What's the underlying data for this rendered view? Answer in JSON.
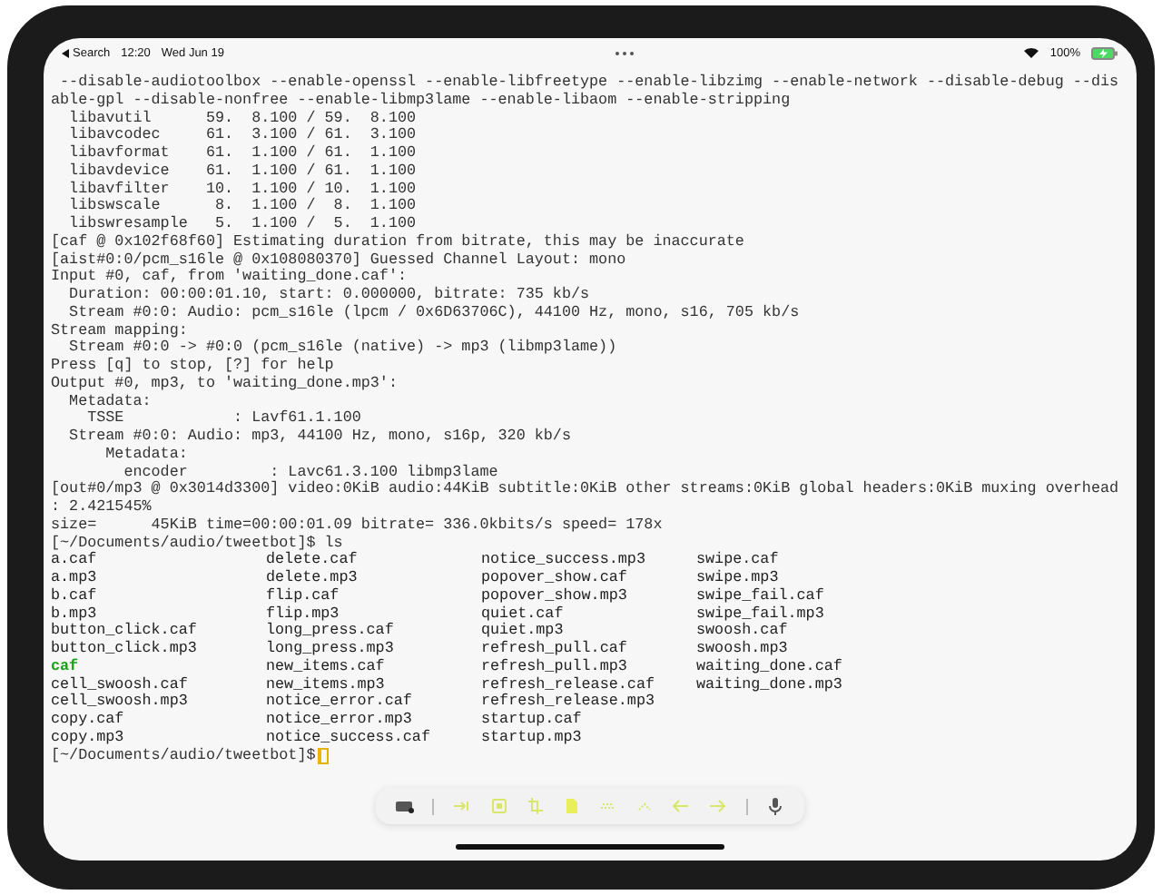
{
  "status_bar": {
    "back_label": "Search",
    "time": "12:20",
    "date": "Wed Jun 19",
    "battery": "100%",
    "charging": true
  },
  "terminal": {
    "lines": [
      {
        "kind": "output",
        "text": " --disable-audiotoolbox --enable-openssl --enable-libfreetype --enable-libzimg --enable-network --disable-debug --dis"
      },
      {
        "kind": "output",
        "text": "able-gpl --disable-nonfree --enable-libmp3lame --enable-libaom --enable-stripping"
      },
      {
        "kind": "output",
        "text": "  libavutil      59.  8.100 / 59.  8.100"
      },
      {
        "kind": "output",
        "text": "  libavcodec     61.  3.100 / 61.  3.100"
      },
      {
        "kind": "output",
        "text": "  libavformat    61.  1.100 / 61.  1.100"
      },
      {
        "kind": "output",
        "text": "  libavdevice    61.  1.100 / 61.  1.100"
      },
      {
        "kind": "output",
        "text": "  libavfilter    10.  1.100 / 10.  1.100"
      },
      {
        "kind": "output",
        "text": "  libswscale      8.  1.100 /  8.  1.100"
      },
      {
        "kind": "output",
        "text": "  libswresample   5.  1.100 /  5.  1.100"
      },
      {
        "kind": "output",
        "text": "[caf @ 0x102f68f60] Estimating duration from bitrate, this may be inaccurate"
      },
      {
        "kind": "output",
        "text": "[aist#0:0/pcm_s16le @ 0x108080370] Guessed Channel Layout: mono"
      },
      {
        "kind": "output",
        "text": "Input #0, caf, from 'waiting_done.caf':"
      },
      {
        "kind": "output",
        "text": "  Duration: 00:00:01.10, start: 0.000000, bitrate: 735 kb/s"
      },
      {
        "kind": "output",
        "text": "  Stream #0:0: Audio: pcm_s16le (lpcm / 0x6D63706C), 44100 Hz, mono, s16, 705 kb/s"
      },
      {
        "kind": "output",
        "text": "Stream mapping:"
      },
      {
        "kind": "output",
        "text": "  Stream #0:0 -> #0:0 (pcm_s16le (native) -> mp3 (libmp3lame))"
      },
      {
        "kind": "output",
        "text": "Press [q] to stop, [?] for help"
      },
      {
        "kind": "output",
        "text": "Output #0, mp3, to 'waiting_done.mp3':"
      },
      {
        "kind": "output",
        "text": "  Metadata:"
      },
      {
        "kind": "output",
        "text": "    TSSE            : Lavf61.1.100"
      },
      {
        "kind": "output",
        "text": "  Stream #0:0: Audio: mp3, 44100 Hz, mono, s16p, 320 kb/s"
      },
      {
        "kind": "output",
        "text": "      Metadata:"
      },
      {
        "kind": "output",
        "text": "        encoder         : Lavc61.3.100 libmp3lame"
      },
      {
        "kind": "output",
        "text": "[out#0/mp3 @ 0x3014d3300] video:0KiB audio:44KiB subtitle:0KiB other streams:0KiB global headers:0KiB muxing overhead"
      },
      {
        "kind": "output",
        "text": ": 2.421545%"
      },
      {
        "kind": "output",
        "text": "size=      45KiB time=00:00:01.09 bitrate= 336.0kbits/s speed= 178x"
      }
    ],
    "command": "[~/Documents/audio/tweetbot]$ ls",
    "listing": [
      [
        {
          "name": "a.caf",
          "kind": "file"
        },
        {
          "name": "delete.caf",
          "kind": "file"
        },
        {
          "name": "notice_success.mp3",
          "kind": "file"
        },
        {
          "name": "swipe.caf",
          "kind": "file"
        }
      ],
      [
        {
          "name": "a.mp3",
          "kind": "file"
        },
        {
          "name": "delete.mp3",
          "kind": "file"
        },
        {
          "name": "popover_show.caf",
          "kind": "file"
        },
        {
          "name": "swipe.mp3",
          "kind": "file"
        }
      ],
      [
        {
          "name": "b.caf",
          "kind": "file"
        },
        {
          "name": "flip.caf",
          "kind": "file"
        },
        {
          "name": "popover_show.mp3",
          "kind": "file"
        },
        {
          "name": "swipe_fail.caf",
          "kind": "file"
        }
      ],
      [
        {
          "name": "b.mp3",
          "kind": "file"
        },
        {
          "name": "flip.mp3",
          "kind": "file"
        },
        {
          "name": "quiet.caf",
          "kind": "file"
        },
        {
          "name": "swipe_fail.mp3",
          "kind": "file"
        }
      ],
      [
        {
          "name": "button_click.caf",
          "kind": "file"
        },
        {
          "name": "long_press.caf",
          "kind": "file"
        },
        {
          "name": "quiet.mp3",
          "kind": "file"
        },
        {
          "name": "swoosh.caf",
          "kind": "file"
        }
      ],
      [
        {
          "name": "button_click.mp3",
          "kind": "file"
        },
        {
          "name": "long_press.mp3",
          "kind": "file"
        },
        {
          "name": "refresh_pull.caf",
          "kind": "file"
        },
        {
          "name": "swoosh.mp3",
          "kind": "file"
        }
      ],
      [
        {
          "name": "caf",
          "kind": "directory"
        },
        {
          "name": "new_items.caf",
          "kind": "file"
        },
        {
          "name": "refresh_pull.mp3",
          "kind": "file"
        },
        {
          "name": "waiting_done.caf",
          "kind": "file"
        }
      ],
      [
        {
          "name": "cell_swoosh.caf",
          "kind": "file"
        },
        {
          "name": "new_items.mp3",
          "kind": "file"
        },
        {
          "name": "refresh_release.caf",
          "kind": "file"
        },
        {
          "name": "waiting_done.mp3",
          "kind": "file"
        }
      ],
      [
        {
          "name": "cell_swoosh.mp3",
          "kind": "file"
        },
        {
          "name": "notice_error.caf",
          "kind": "file"
        },
        {
          "name": "refresh_release.mp3",
          "kind": "file"
        }
      ],
      [
        {
          "name": "copy.caf",
          "kind": "file"
        },
        {
          "name": "notice_error.mp3",
          "kind": "file"
        },
        {
          "name": "startup.caf",
          "kind": "file"
        }
      ],
      [
        {
          "name": "copy.mp3",
          "kind": "file"
        },
        {
          "name": "notice_success.caf",
          "kind": "file"
        },
        {
          "name": "startup.mp3",
          "kind": "file"
        }
      ]
    ],
    "prompt": {
      "text": "[~/Documents/audio/tweetbot]$",
      "cursor": true
    }
  }
}
